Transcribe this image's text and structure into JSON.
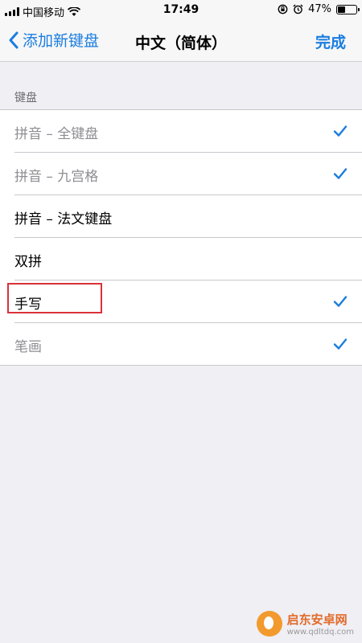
{
  "status_bar": {
    "carrier": "中国移动",
    "time": "17:49",
    "battery_percent": "47%",
    "battery_level": 0.47
  },
  "nav": {
    "back_label": "添加新键盘",
    "title": "中文（简体）",
    "done_label": "完成"
  },
  "section": {
    "header": "键盘"
  },
  "keyboards": [
    {
      "label": "拼音 – 全键盘",
      "checked": true,
      "muted": true
    },
    {
      "label": "拼音 – 九宫格",
      "checked": true,
      "muted": true
    },
    {
      "label": "拼音 – 法文键盘",
      "checked": false,
      "muted": false
    },
    {
      "label": "双拼",
      "checked": false,
      "muted": false
    },
    {
      "label": "手写",
      "checked": true,
      "muted": false,
      "highlighted": true
    },
    {
      "label": "笔画",
      "checked": true,
      "muted": true
    }
  ],
  "colors": {
    "accent": "#1a7de0",
    "highlight": "#d9323a"
  },
  "watermark": {
    "name": "启东安卓网",
    "url": "www.qdltdq.com"
  }
}
